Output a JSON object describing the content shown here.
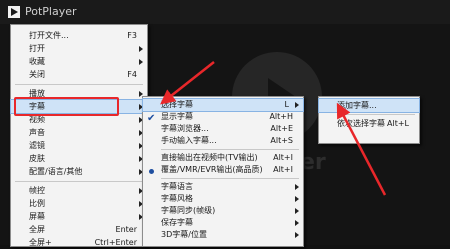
{
  "app": {
    "title": "PotPlayer"
  },
  "background": {
    "text": "er"
  },
  "main_menu": [
    {
      "label": "打开文件...",
      "shortcut": "F3"
    },
    {
      "label": "打开",
      "submenu": true
    },
    {
      "label": "收藏",
      "submenu": true
    },
    {
      "label": "关闭",
      "shortcut": "F4"
    },
    {
      "separator": true
    },
    {
      "label": "播放",
      "submenu": true
    },
    {
      "label": "字幕",
      "submenu": true,
      "highlighted": true
    },
    {
      "label": "视频",
      "submenu": true
    },
    {
      "label": "声音",
      "submenu": true
    },
    {
      "label": "滤镜",
      "submenu": true
    },
    {
      "label": "皮肤",
      "submenu": true
    },
    {
      "label": "配置/语言/其他",
      "submenu": true
    },
    {
      "separator": true
    },
    {
      "label": "帧控",
      "submenu": true
    },
    {
      "label": "比例",
      "submenu": true
    },
    {
      "label": "屏幕",
      "submenu": true
    },
    {
      "label": "全屏",
      "shortcut": "Enter"
    },
    {
      "label": "全屏+",
      "shortcut": "Ctrl+Enter"
    }
  ],
  "subtitle_menu": [
    {
      "label": "选择字幕",
      "shortcut": "L",
      "submenu": true,
      "highlighted": true
    },
    {
      "label": "显示字幕",
      "shortcut": "Alt+H",
      "checked": true
    },
    {
      "label": "字幕浏览器...",
      "shortcut": "Alt+E"
    },
    {
      "label": "手动输入字幕...",
      "shortcut": "Alt+S"
    },
    {
      "separator": true
    },
    {
      "label": "直接输出在视频中(TV输出)",
      "shortcut": "Alt+I"
    },
    {
      "label": "覆盖/VMR/EVR输出(高品质)",
      "shortcut": "Alt+I",
      "radio": true
    },
    {
      "separator": true
    },
    {
      "label": "字幕语言",
      "submenu": true
    },
    {
      "label": "字幕风格",
      "submenu": true
    },
    {
      "label": "字幕同步(帧级)",
      "submenu": true
    },
    {
      "label": "保存字幕",
      "submenu": true
    },
    {
      "label": "3D字幕/位置",
      "submenu": true
    }
  ],
  "select_subtitle_menu": [
    {
      "label": "添加字幕...",
      "highlighted": true
    },
    {
      "separator": true
    },
    {
      "label": "依次选择字幕",
      "shortcut": "Alt+L"
    }
  ],
  "colors": {
    "highlight_box": "#e8272a",
    "arrow": "#e8272a",
    "menu_bg": "#f3f3f3"
  }
}
